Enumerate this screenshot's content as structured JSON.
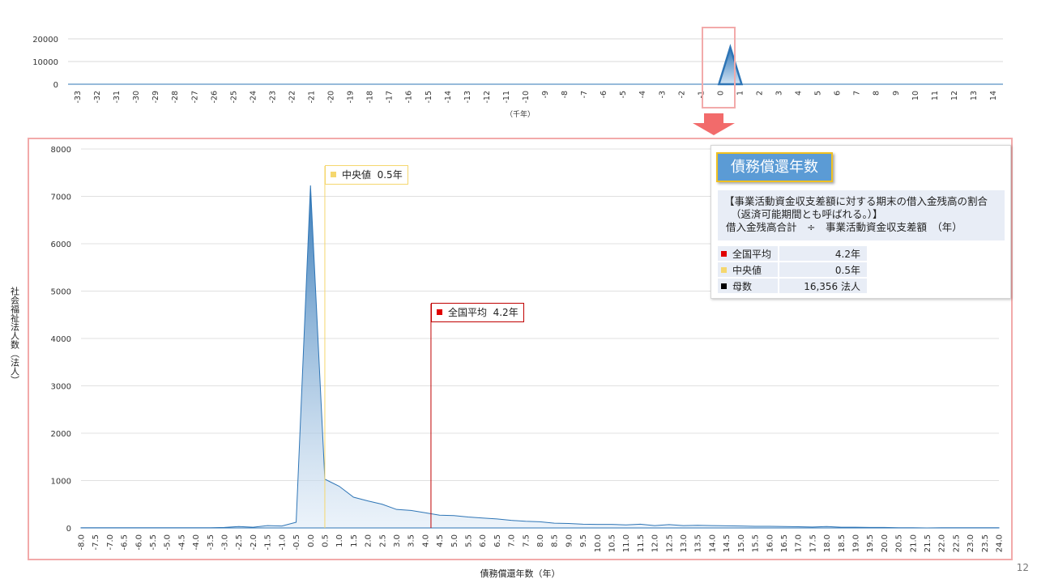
{
  "page_number": "12",
  "colors": {
    "area_blue": "#2e75b6",
    "median_yellow": "#f5d76e",
    "average_red": "#c00000",
    "population_black": "#000000",
    "frame_pink": "#f2aaaa",
    "title_blue": "#5b9bd5",
    "title_border": "#f0c020"
  },
  "info": {
    "title": "債務償還年数",
    "desc_line1": "【事業活動資金収支差額に対する期末の借入金残高の割合",
    "desc_line2": "（返済可能期間とも呼ばれる。）】",
    "desc_line3": "借入金残高合計　÷　事業活動資金収支差額　（年）",
    "stats": [
      {
        "icon": "red-square-icon",
        "color": "#e00000",
        "label": "全国平均",
        "value": "4.2年"
      },
      {
        "icon": "yellow-square-icon",
        "color": "#f5d76e",
        "label": "中央値",
        "value": "0.5年"
      },
      {
        "icon": "black-square-icon",
        "color": "#000000",
        "label": "母数",
        "value": "16,356 法人"
      }
    ]
  },
  "chart_data": [
    {
      "type": "area",
      "xlabel": "（千年）",
      "ylabel": "",
      "ylim": [
        0,
        20000
      ],
      "yticks": [
        "20000",
        "10000",
        "0"
      ],
      "categories": [
        "-33",
        "-32",
        "-31",
        "-30",
        "-29",
        "-28",
        "-27",
        "-26",
        "-25",
        "-24",
        "-23",
        "-22",
        "-21",
        "-20",
        "-19",
        "-18",
        "-17",
        "-16",
        "-15",
        "-14",
        "-13",
        "-12",
        "-11",
        "-10",
        "-9",
        "-8",
        "-7",
        "-6",
        "-5",
        "-4",
        "-3",
        "-2",
        "-1",
        "0",
        "1",
        "2",
        "3",
        "4",
        "5",
        "6",
        "7",
        "8",
        "9",
        "10",
        "11",
        "12",
        "13",
        "14"
      ],
      "peak": {
        "x_from": 0,
        "x_to": 1,
        "value": 16300
      },
      "grid": true
    },
    {
      "type": "area",
      "xlabel": "債務償還年数（年）",
      "ylabel": "社会福祉法人数（法人）",
      "ylim": [
        0,
        8000
      ],
      "yticks": [
        "0",
        "1000",
        "2000",
        "3000",
        "4000",
        "5000",
        "6000",
        "7000",
        "8000"
      ],
      "x": [
        "-8.0",
        "-7.5",
        "-7.0",
        "-6.5",
        "-6.0",
        "-5.5",
        "-5.0",
        "-4.5",
        "-4.0",
        "-3.5",
        "-3.0",
        "-2.5",
        "-2.0",
        "-1.5",
        "-1.0",
        "-0.5",
        "0.0",
        "0.5",
        "1.0",
        "1.5",
        "2.0",
        "2.5",
        "3.0",
        "3.5",
        "4.0",
        "4.5",
        "5.0",
        "5.5",
        "6.0",
        "6.5",
        "7.0",
        "7.5",
        "8.0",
        "8.5",
        "9.0",
        "9.5",
        "10.0",
        "10.5",
        "11.0",
        "11.5",
        "12.0",
        "12.5",
        "13.0",
        "13.5",
        "14.0",
        "14.5",
        "15.0",
        "15.5",
        "16.0",
        "16.5",
        "17.0",
        "17.5",
        "18.0",
        "18.5",
        "19.0",
        "19.5",
        "20.0",
        "20.5",
        "21.0",
        "21.5",
        "22.0",
        "22.5",
        "23.0",
        "23.5",
        "24.0"
      ],
      "values": [
        5,
        5,
        5,
        5,
        5,
        5,
        5,
        5,
        5,
        5,
        10,
        30,
        15,
        50,
        40,
        120,
        7230,
        1030,
        880,
        650,
        570,
        500,
        390,
        370,
        320,
        270,
        260,
        230,
        210,
        190,
        160,
        140,
        130,
        100,
        95,
        80,
        75,
        75,
        65,
        80,
        50,
        70,
        50,
        55,
        50,
        45,
        40,
        35,
        35,
        30,
        25,
        20,
        30,
        15,
        15,
        10,
        10,
        5,
        5,
        0,
        5,
        5,
        5,
        5,
        5
      ],
      "median": {
        "value": 0.5,
        "label": "中央値",
        "text": "0.5年"
      },
      "average": {
        "value": 4.2,
        "label": "全国平均",
        "text": "4.2年"
      },
      "grid": true
    }
  ]
}
